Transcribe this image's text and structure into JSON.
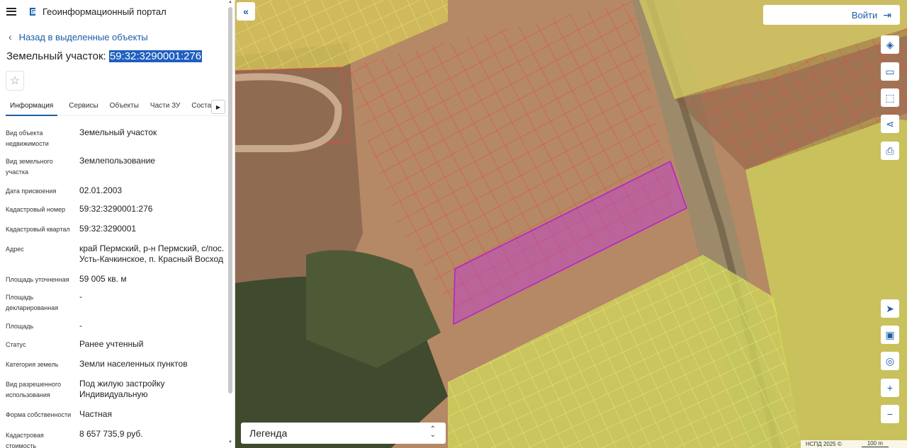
{
  "header": {
    "title": "Геоинформационный портал"
  },
  "nav": {
    "back_label": "Назад в выделенные объекты"
  },
  "object": {
    "title_prefix": "Земельный участок:",
    "cadastral_number": "59:32:3290001:276"
  },
  "tabs": [
    {
      "label": "Информация",
      "active": true
    },
    {
      "label": "Сервисы"
    },
    {
      "label": "Объекты"
    },
    {
      "label": "Части ЗУ"
    },
    {
      "label": "Соста"
    }
  ],
  "attributes": [
    {
      "key": "Вид объекта недвижимости",
      "value": "Земельный участок"
    },
    {
      "key": "Вид земельного участка",
      "value": "Землепользование"
    },
    {
      "key": "Дата присвоения",
      "value": "02.01.2003"
    },
    {
      "key": "Кадастровый номер",
      "value": "59:32:3290001:276"
    },
    {
      "key": "Кадастровый квартал",
      "value": "59:32:3290001"
    },
    {
      "key": "Адрес",
      "value": "край Пермский, р-н Пермский, с/пос. Усть-Качкинское, п. Красный Восход"
    },
    {
      "key": "Площадь уточненная",
      "value": "59 005 кв. м"
    },
    {
      "key": "Площадь декларированная",
      "value": "-"
    },
    {
      "key": "Площадь",
      "value": "-"
    },
    {
      "key": "Статус",
      "value": "Ранее учтенный"
    },
    {
      "key": "Категория земель",
      "value": "Земли населенных пунктов"
    },
    {
      "key": "Вид разрешенного использования",
      "value": "Под жилую застройку Индивидуальную"
    },
    {
      "key": "Форма собственности",
      "value": "Частная"
    },
    {
      "key": "Кадастровая стоимость",
      "value": "8 657 735,9 руб."
    }
  ],
  "map": {
    "login_label": "Войти",
    "legend_label": "Легенда",
    "attribution": "НСПД 2025 ©",
    "scale_label": "100 m",
    "tools": [
      "layers-icon",
      "ruler-icon",
      "select-area-icon",
      "share-icon",
      "print-icon",
      "locate-icon",
      "minimap-icon",
      "geolocation-icon",
      "zoom-in-icon",
      "zoom-out-icon"
    ],
    "colors": {
      "parcel_border": "#e8473a",
      "selected": "#c23ad6",
      "zone_fill": "#e6de5a"
    }
  }
}
